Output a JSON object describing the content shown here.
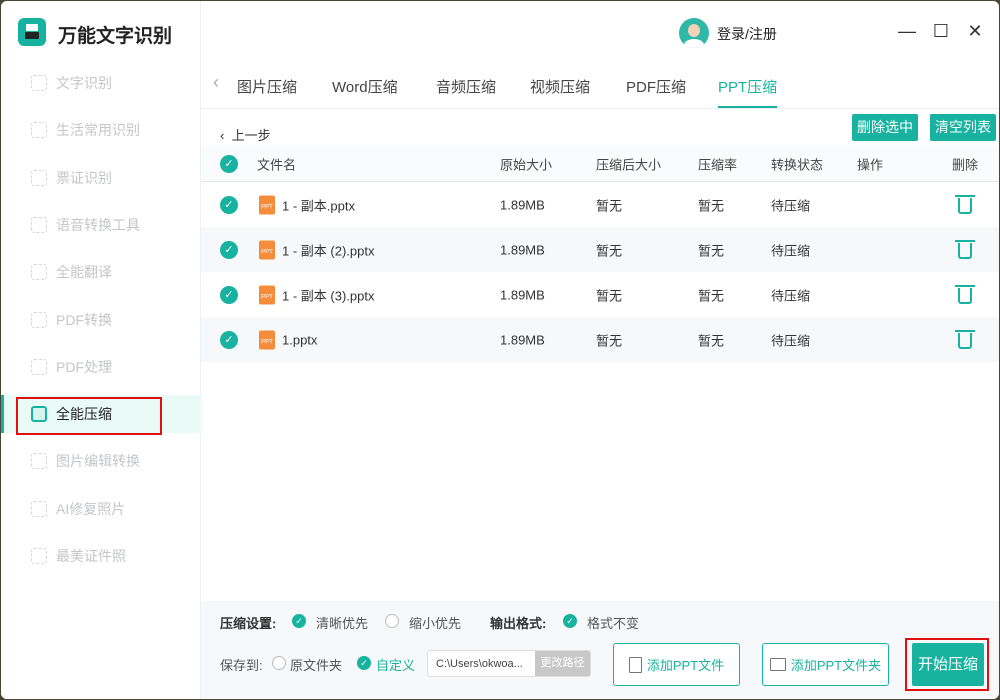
{
  "app": {
    "title": "万能文字识别"
  },
  "sidebar": {
    "items": [
      {
        "label": "文字识别"
      },
      {
        "label": "生活常用识别"
      },
      {
        "label": "票证识别"
      },
      {
        "label": "语音转换工具"
      },
      {
        "label": "全能翻译"
      },
      {
        "label": "PDF转换"
      },
      {
        "label": "PDF处理"
      },
      {
        "label": "全能压缩",
        "active": true
      },
      {
        "label": "图片编辑转换"
      },
      {
        "label": "AI修复照片"
      },
      {
        "label": "最美证件照"
      }
    ]
  },
  "header": {
    "login": "登录/注册",
    "minimize": "—",
    "maximize": "☐",
    "close": "✕"
  },
  "tabs": [
    "图片压缩",
    "Word压缩",
    "音频压缩",
    "视频压缩",
    "PDF压缩",
    "PPT压缩"
  ],
  "active_tab": "PPT压缩",
  "toolbar": {
    "back": "上一步",
    "delete_selected": "删除选中",
    "clear_list": "清空列表"
  },
  "table": {
    "headers": [
      "文件名",
      "原始大小",
      "压缩后大小",
      "压缩率",
      "转换状态",
      "操作",
      "删除"
    ],
    "rows": [
      {
        "name": "1 - 副本.pptx",
        "original": "1.89MB",
        "compressed": "暂无",
        "rate": "暂无",
        "status": "待压缩"
      },
      {
        "name": "1 - 副本 (2).pptx",
        "original": "1.89MB",
        "compressed": "暂无",
        "rate": "暂无",
        "status": "待压缩"
      },
      {
        "name": "1 - 副本 (3).pptx",
        "original": "1.89MB",
        "compressed": "暂无",
        "rate": "暂无",
        "status": "待压缩"
      },
      {
        "name": "1.pptx",
        "original": "1.89MB",
        "compressed": "暂无",
        "rate": "暂无",
        "status": "待压缩"
      }
    ]
  },
  "settings": {
    "compress_label": "压缩设置:",
    "opt_clear": "清晰优先",
    "opt_small": "缩小优先",
    "output_label": "输出格式:",
    "opt_keep": "格式不变",
    "save_label": "保存到:",
    "save_orig": "原文件夹",
    "save_custom": "自定义",
    "path": "C:\\Users\\okwoa...",
    "change_path": "更改路径"
  },
  "actions": {
    "add_file": "添加PPT文件",
    "add_folder": "添加PPT文件夹",
    "start": "开始压缩"
  },
  "colors": {
    "accent": "#17b3a0",
    "highlight": "#e01010"
  }
}
